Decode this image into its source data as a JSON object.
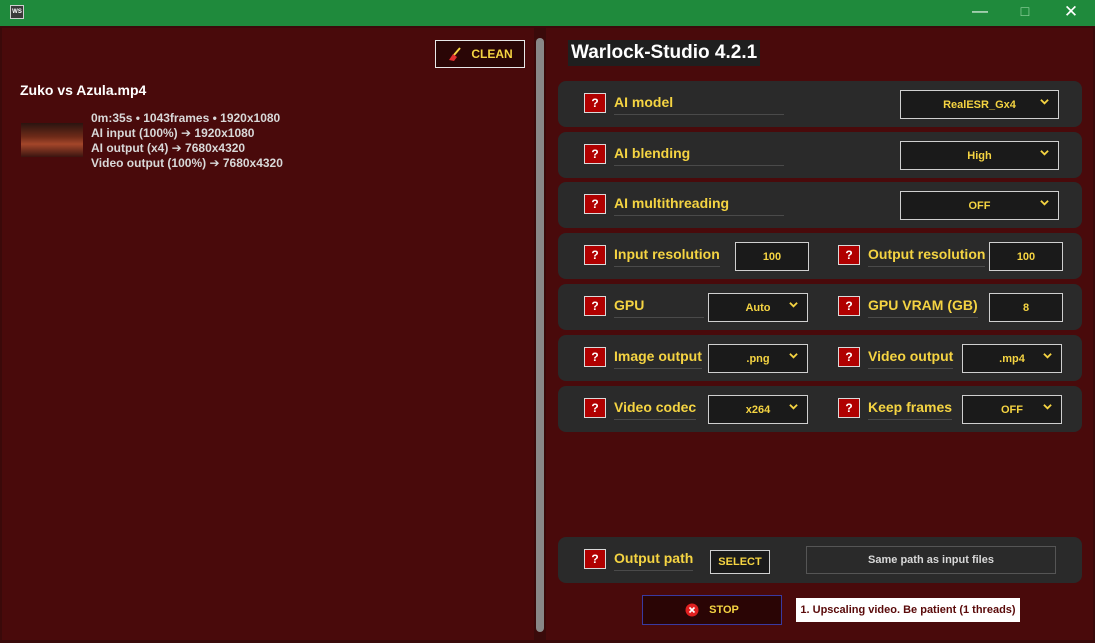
{
  "window": {
    "icon_text": "WS",
    "controls": {
      "minimize": "—",
      "maximize": "☐",
      "close": "✕"
    }
  },
  "left_panel": {
    "clean_label": "CLEAN",
    "file": {
      "name": "Zuko vs Azula.mp4",
      "info_lines": [
        "0m:35s • 1043frames • 1920x1080",
        "AI input (100%) ➔ 1920x1080",
        "AI output (x4) ➔ 7680x4320",
        "Video output (100%) ➔ 7680x4320"
      ]
    }
  },
  "right_panel": {
    "title": "Warlock-Studio 4.2.1",
    "help_symbol": "?",
    "settings": {
      "ai_model": {
        "label": "AI model",
        "value": "RealESR_Gx4"
      },
      "ai_blending": {
        "label": "AI blending",
        "value": "High"
      },
      "ai_multithreading": {
        "label": "AI multithreading",
        "value": "OFF"
      },
      "input_resolution": {
        "label": "Input resolution",
        "value": "100"
      },
      "output_resolution": {
        "label": "Output resolution",
        "value": "100"
      },
      "gpu": {
        "label": "GPU",
        "value": "Auto"
      },
      "gpu_vram": {
        "label": "GPU VRAM (GB)",
        "value": "8"
      },
      "image_output": {
        "label": "Image output",
        "value": ".png"
      },
      "video_output": {
        "label": "Video output",
        "value": ".mp4"
      },
      "video_codec": {
        "label": "Video codec",
        "value": "x264"
      },
      "keep_frames": {
        "label": "Keep frames",
        "value": "OFF"
      },
      "output_path": {
        "label": "Output path",
        "select_label": "SELECT",
        "value": "Same path as input files"
      }
    },
    "stop_label": "STOP",
    "status": "1. Upscaling video. Be patient (1 threads)"
  },
  "colors": {
    "titlebar": "#1f8a3c",
    "panel_bg": "#490a0b",
    "row_bg": "#2a2a2a",
    "accent_text": "#f5d442",
    "help_bg": "#b00000"
  }
}
